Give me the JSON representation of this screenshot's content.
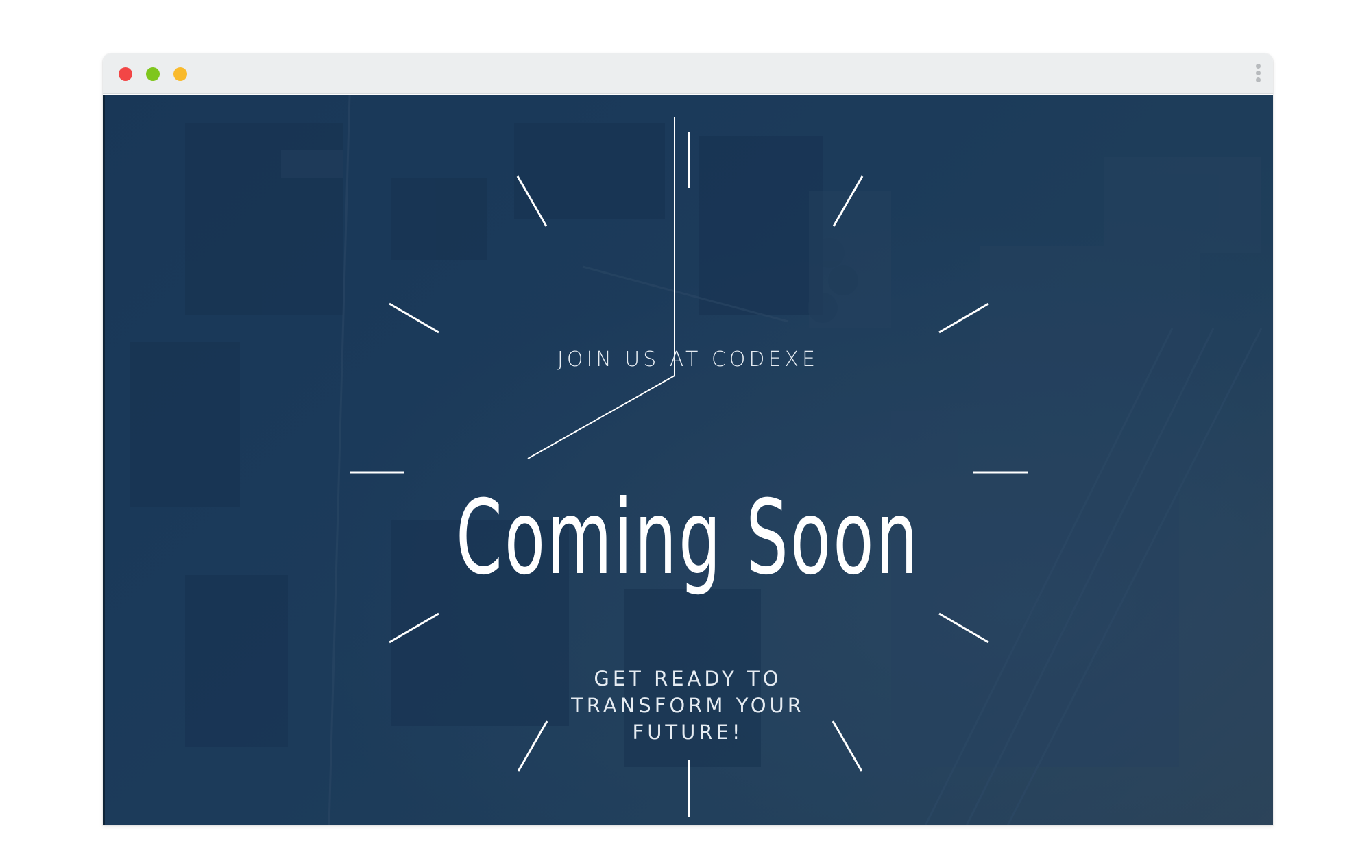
{
  "window": {
    "controls": {
      "close_color": "#f24646",
      "minimize_color": "#7fc61d",
      "maximize_color": "#f9ba2c"
    },
    "menu_icon": "kebab-menu-icon"
  },
  "hero": {
    "eyebrow": "JOIN US AT CODEXE",
    "title": "Coming Soon",
    "tagline_lines": [
      "GET READY TO",
      "TRANSFORM YOUR",
      "FUTURE!"
    ],
    "background": "aerial-city-photo",
    "overlay_color": "#1b3a5a"
  }
}
